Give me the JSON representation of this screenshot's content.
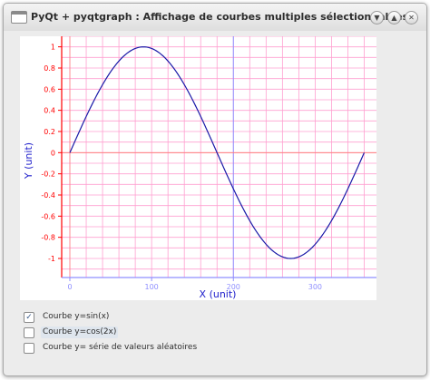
{
  "window": {
    "title": "PyQt + pyqtgraph : Affichage de courbes multiples sélectionnables",
    "buttons": [
      "minimize",
      "maximize",
      "close"
    ]
  },
  "plot": {
    "xlabel": "X (unit)",
    "ylabel": "Y (unit)",
    "x_ticks": [
      "0",
      "100",
      "200",
      "300"
    ],
    "y_ticks": [
      "1",
      "0.8",
      "0.6",
      "0.4",
      "0.2",
      "0",
      "-0.2",
      "-0.4",
      "-0.6",
      "-0.8",
      "-1"
    ]
  },
  "chart_data": {
    "type": "line",
    "title": "",
    "xlabel": "X (unit)",
    "ylabel": "Y (unit)",
    "xlim": [
      -10,
      375
    ],
    "ylim": [
      -1.18,
      1.1
    ],
    "grid": true,
    "series": [
      {
        "name": "Courbe y=sin(x)",
        "visible": true,
        "function": "sin(x)",
        "x_range": [
          0,
          360
        ],
        "x_unit": "degrees",
        "color": "#1a1aa8"
      }
    ],
    "colors": {
      "axis": "#ff0000",
      "grid": "#ff9fd0",
      "zero_lines": "#8f8fff",
      "curve": "#1a1aa8",
      "label": "#2222cc"
    }
  },
  "checkboxes": [
    {
      "label": "Courbe y=sin(x)",
      "checked": true
    },
    {
      "label": "Courbe y=cos(2x)",
      "checked": false
    },
    {
      "label": "Courbe y= série de valeurs aléatoires",
      "checked": false
    }
  ]
}
